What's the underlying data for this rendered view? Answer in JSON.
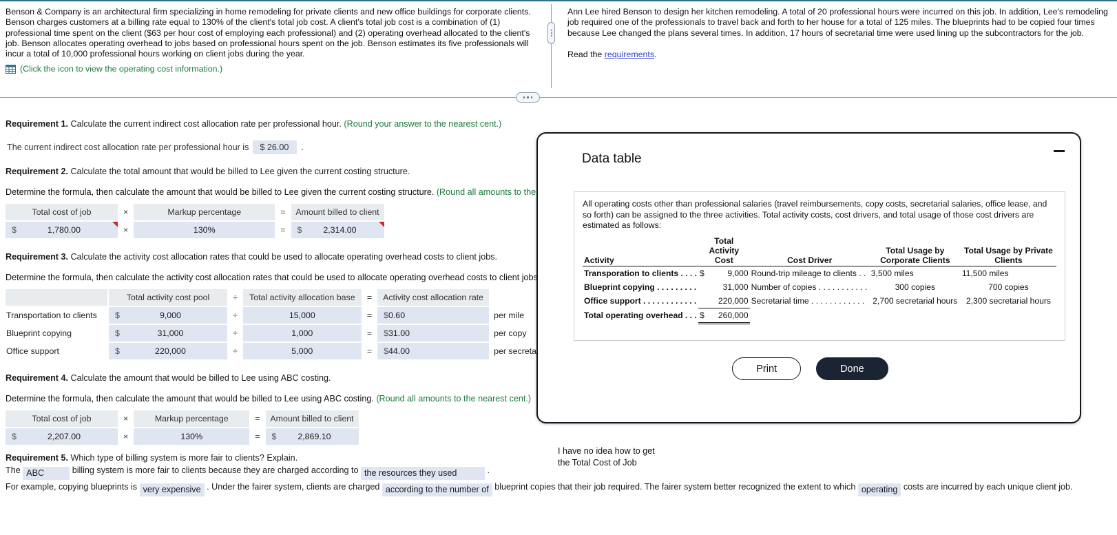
{
  "problem": {
    "left_paragraph": "Benson & Company is an architectural firm specializing in home remodeling for private clients and new office buildings for corporate clients. Benson charges customers at a billing rate equal to 130% of the client's total job cost. A client's total job cost is a combination of (1) professional time spent on the client ($63 per hour cost of employing each professional) and (2) operating overhead allocated to the client's job. Benson allocates operating overhead to jobs based on professional hours spent on the job. Benson estimates its five professionals will incur a total of 10,000 professional hours working on client jobs during the year.",
    "icon_hint": "(Click the icon to view the operating cost information.)",
    "right_paragraph": "Ann Lee hired Benson to design her kitchen remodeling. A total of 20 professional hours were incurred on this job. In addition, Lee's remodeling job required one of the professionals to travel back and forth to her house for a total of 125 miles. The blueprints had to be copied four times because Lee changed the plans several times. In addition, 17 hours of secretarial time were used lining up the subcontractors for the job.",
    "read_the": "Read the",
    "requirements_link": "requirements",
    "period": "."
  },
  "requirement1": {
    "heading_bold": "Requirement 1.",
    "heading_rest": " Calculate the current indirect cost allocation rate per professional hour.",
    "note": " (Round your answer to the nearest cent.)",
    "answer_prefix": "The current indirect cost allocation rate per professional hour is",
    "answer_value": "$ 26.00",
    "answer_suffix": "."
  },
  "requirement2": {
    "heading_bold": "Requirement 2.",
    "heading_rest": " Calculate the total amount that would be billed to Lee given the current costing structure.",
    "sub": "Determine the formula, then calculate the amount that would be billed to Lee given the current costing structure.",
    "note": " (Round all amounts to the ",
    "headers": [
      "Total cost of job",
      "×",
      "Markup percentage",
      "=",
      "Amount billed to client"
    ],
    "row": {
      "total_cost_symbol": "$",
      "total_cost": "1,780.00",
      "op1": "×",
      "markup": "130%",
      "op2": "=",
      "billed_symbol": "$",
      "billed": "2,314.00"
    }
  },
  "requirement3": {
    "heading_bold": "Requirement 3.",
    "heading_rest": " Calculate the activity cost allocation rates that could be used to allocate operating overhead costs to client jobs.",
    "sub": "Determine the formula, then calculate the activity cost allocation rates that could be used to allocate operating overhead costs to client jobs.",
    "headers": [
      "",
      "Total activity cost pool",
      "÷",
      "Total activity allocation base",
      "=",
      "Activity cost allocation rate"
    ],
    "rows": [
      {
        "label": "Transportation to clients",
        "pool_sym": "$",
        "pool": "9,000",
        "op1": "÷",
        "base": "15,000",
        "op2": "=",
        "rate_sym": "$",
        "rate": "0.60",
        "unit": "per mile"
      },
      {
        "label": "Blueprint copying",
        "pool_sym": "$",
        "pool": "31,000",
        "op1": "÷",
        "base": "1,000",
        "op2": "=",
        "rate_sym": "$",
        "rate": "31.00",
        "unit": "per copy"
      },
      {
        "label": "Office support",
        "pool_sym": "$",
        "pool": "220,000",
        "op1": "÷",
        "base": "5,000",
        "op2": "=",
        "rate_sym": "$",
        "rate": "44.00",
        "unit": "per secretarial hour"
      }
    ]
  },
  "requirement4": {
    "heading_bold": "Requirement 4.",
    "heading_rest": " Calculate the amount that would be billed to Lee using ABC costing.",
    "sub": "Determine the formula, then calculate the amount that would be billed to Lee using ABC costing.",
    "note": " (Round all amounts to the nearest cent.)",
    "headers": [
      "Total cost of job",
      "×",
      "Markup percentage",
      "=",
      "Amount billed to client"
    ],
    "row": {
      "total_cost_symbol": "$",
      "total_cost": "2,207.00",
      "op1": "×",
      "markup": "130%",
      "op2": "=",
      "billed_symbol": "$",
      "billed": "2,869.10"
    }
  },
  "requirement5": {
    "heading_bold": "Requirement 5.",
    "heading_rest": " Which type of billing system is more fair to clients? Explain.",
    "line1_a": "The",
    "line1_blank1": "ABC",
    "line1_b": "billing system is more fair to clients because they are charged according to",
    "line1_blank2": "the resources they used",
    "line1_c": ".",
    "line2_a": "For example, copying blueprints is",
    "line2_blank1": "very expensive",
    "line2_b": ". Under the fairer system, clients are charged",
    "line2_blank2": "according to the number of",
    "line2_c": "blueprint copies that their job required. The fairer system better recognized the extent to which",
    "line2_blank3": "operating",
    "line2_d": "costs are incurred by each unique client job."
  },
  "annotation": {
    "line1": "I have no idea how to get",
    "line2": "the Total Cost of Job"
  },
  "modal": {
    "title": "Data table",
    "intro": "All operating costs other than professional salaries (travel reimbursements, copy costs, secretarial salaries, office lease, and so forth) can be assigned to the three activities. Total activity costs, cost drivers, and total usage of those cost drivers are estimated as follows:",
    "headers": {
      "activity": "Activity",
      "total_activity_cost": [
        "Total",
        "Activity",
        "Cost"
      ],
      "cost_driver": "Cost Driver",
      "usage_corporate": [
        "Total Usage by",
        "Corporate Clients"
      ],
      "usage_private": [
        "Total Usage by Private",
        "Clients"
      ]
    },
    "rows": [
      {
        "activity": "Transporation to clients . . . .",
        "cost_symbol": "$",
        "cost": "9,000",
        "driver": "Round-trip mileage to clients  . .",
        "corporate": "3,500 miles",
        "private": "11,500 miles"
      },
      {
        "activity": "Blueprint copying . . . . . . . . .",
        "cost_symbol": "",
        "cost": "31,000",
        "driver": "Number of copies . . . . . . . . . . .",
        "corporate": "300 copies",
        "private": "700 copies"
      },
      {
        "activity": "Office support . . . . . . . . . . . .",
        "cost_symbol": "",
        "cost": "220,000",
        "driver": "Secretarial time . . . . . . . . . . . .",
        "corporate": "2,700 secretarial hours",
        "private": "2,300 secretarial hours"
      }
    ],
    "total_label": "Total operating overhead . . .",
    "total_symbol": "$",
    "total_value": "260,000",
    "print_label": "Print",
    "done_label": "Done",
    "minimize_label": "—"
  },
  "colors": {
    "accent_border": "#2f6f8f",
    "field_fill": "#dfe6f2",
    "header_fill": "#e9ecef",
    "note_green": "#1b7a3d",
    "link_blue": "#2e43c8",
    "flag_red": "#e02020",
    "modal_dark": "#1b2433"
  }
}
